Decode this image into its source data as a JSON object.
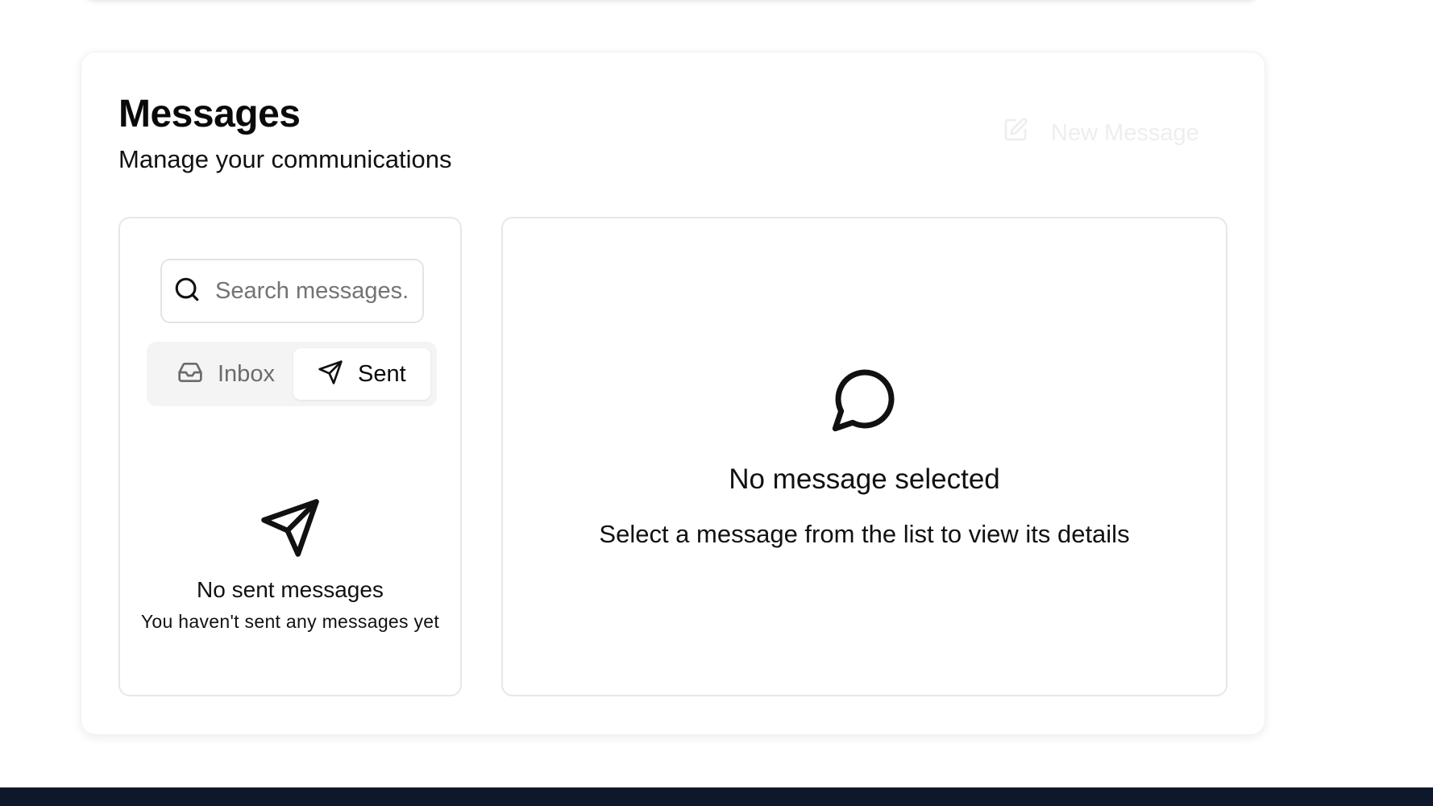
{
  "header": {
    "title": "Messages",
    "subtitle": "Manage your communications",
    "new_message_label": "New Message"
  },
  "search": {
    "placeholder": "Search messages..."
  },
  "tabs": [
    {
      "label": "Inbox",
      "icon": "inbox-icon",
      "active": false
    },
    {
      "label": "Sent",
      "icon": "send-icon",
      "active": true
    }
  ],
  "empty_list": {
    "icon": "send-icon",
    "title": "No sent messages",
    "description": "You haven't sent any messages yet"
  },
  "empty_detail": {
    "icon": "message-circle-icon",
    "title": "No message selected",
    "description": "Select a message from the list to view its details"
  },
  "colors": {
    "footer": "#0f172a",
    "panel_border": "#e7e7e7",
    "tab_bar_bg": "#f4f4f4",
    "muted_text": "#6b6b6b"
  }
}
